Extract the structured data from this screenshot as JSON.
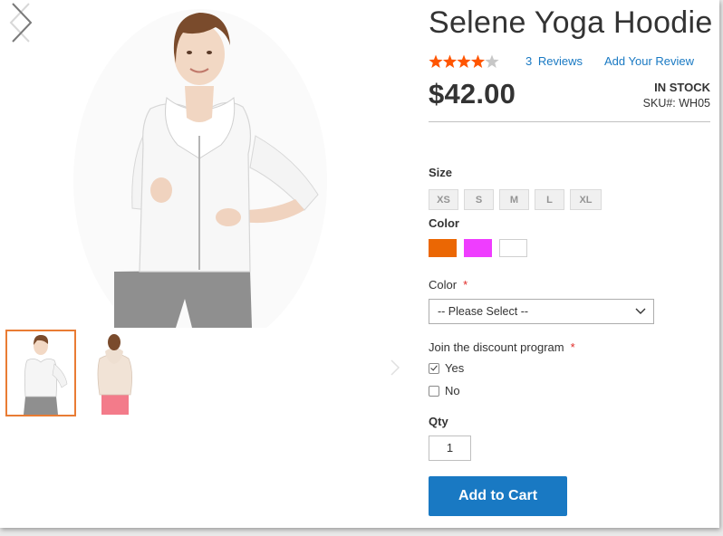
{
  "product": {
    "title": "Selene Yoga Hoodie",
    "rating_stars": 4,
    "rating_max": 5,
    "reviews_link": "3 Reviews",
    "add_review_link": "Add Your Review",
    "price": "$42.00",
    "stock_status": "IN STOCK",
    "sku": "SKU#:  WH05"
  },
  "options": {
    "size_label": "Size",
    "sizes": [
      "XS",
      "S",
      "M",
      "L",
      "XL"
    ],
    "color_label": "Color",
    "colors": [
      "#eb6703",
      "#ef3dff",
      "#ffffff"
    ],
    "color_select_label": "Color",
    "color_select_value": "-- Please Select --",
    "required_mark": "*",
    "discount_label": "Join the discount program",
    "discount_yes": "Yes",
    "discount_no": "No",
    "discount_yes_checked": true,
    "discount_no_checked": false,
    "qty_label": "Qty",
    "qty_value": "1"
  },
  "actions": {
    "add_to_cart": "Add to Cart"
  },
  "colors": {
    "accent_blue": "#1979c3",
    "star_orange": "#ff5501",
    "thumb_active_border": "#e97c34"
  },
  "icons": {
    "prev": "chevron-left-icon",
    "next": "chevron-right-icon",
    "select": "chevron-down-icon"
  }
}
